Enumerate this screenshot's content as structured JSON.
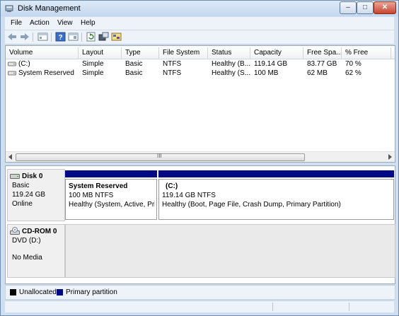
{
  "window": {
    "title": "Disk Management",
    "controls": {
      "minimize": "–",
      "maximize": "□",
      "close": "✕"
    }
  },
  "menu": [
    "File",
    "Action",
    "View",
    "Help"
  ],
  "table": {
    "headers": [
      "Volume",
      "Layout",
      "Type",
      "File System",
      "Status",
      "Capacity",
      "Free Spa...",
      "% Free"
    ],
    "rows": [
      {
        "volume": "(C:)",
        "layout": "Simple",
        "type": "Basic",
        "fs": "NTFS",
        "status": "Healthy (B...",
        "capacity": "119.14 GB",
        "free": "83.77 GB",
        "pct": "70 %"
      },
      {
        "volume": "System Reserved",
        "layout": "Simple",
        "type": "Basic",
        "fs": "NTFS",
        "status": "Healthy (S...",
        "capacity": "100 MB",
        "free": "62 MB",
        "pct": "62 %"
      }
    ],
    "scroll_label": "III"
  },
  "disks": [
    {
      "name": "Disk 0",
      "type": "Basic",
      "size": "119.24 GB",
      "state": "Online",
      "partitions": [
        {
          "title": "System Reserved",
          "size": "100 MB NTFS",
          "status": "Healthy (System, Active, Prir"
        },
        {
          "title": "(C:)",
          "size": "119.14 GB NTFS",
          "status": "Healthy (Boot, Page File, Crash Dump, Primary Partition)"
        }
      ]
    },
    {
      "name": "CD-ROM 0",
      "type": "DVD (D:)",
      "media": "No Media"
    }
  ],
  "legend": [
    {
      "label": "Unallocated",
      "color": "#000000"
    },
    {
      "label": "Primary partition",
      "color": "#000a84"
    }
  ],
  "colors": {
    "primary": "#000a84",
    "unallocated": "#000000",
    "titlebar": "#c4d7ee"
  }
}
